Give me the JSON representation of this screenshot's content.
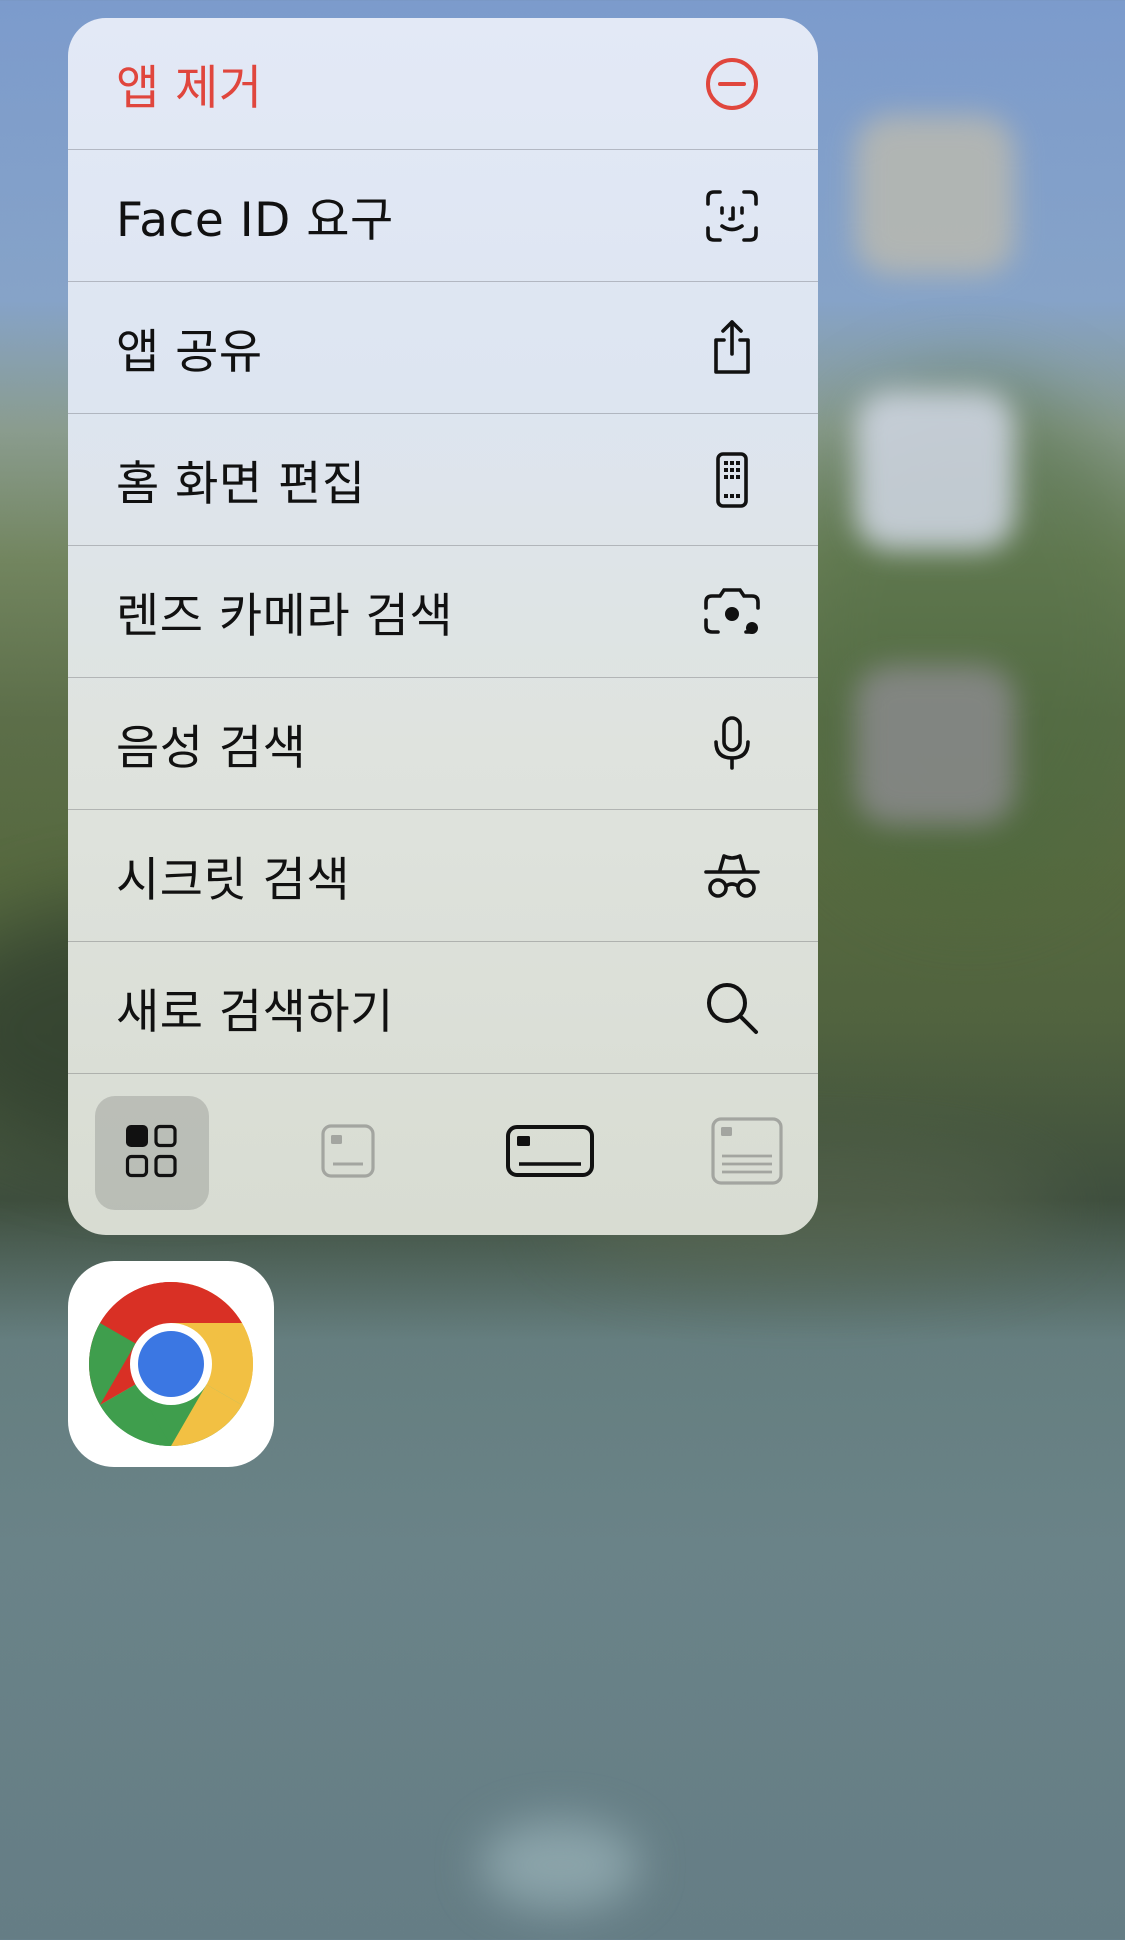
{
  "menu": {
    "items": [
      {
        "label": "앱 제거",
        "icon": "minus-circle-icon",
        "danger": true
      },
      {
        "label": "Face ID 요구",
        "icon": "face-id-icon"
      },
      {
        "label": "앱 공유",
        "icon": "share-icon"
      },
      {
        "label": "홈 화면 편집",
        "icon": "phone-apps-icon"
      },
      {
        "label": "렌즈 카메라 검색",
        "icon": "lens-camera-icon"
      },
      {
        "label": "음성 검색",
        "icon": "microphone-icon"
      },
      {
        "label": "시크릿 검색",
        "icon": "incognito-icon"
      },
      {
        "label": "새로 검색하기",
        "icon": "search-icon"
      }
    ],
    "size_options": [
      {
        "icon": "icon-only-size-icon",
        "selected": true
      },
      {
        "icon": "small-widget-size-icon",
        "selected": false
      },
      {
        "icon": "medium-widget-size-icon",
        "selected": false
      },
      {
        "icon": "large-widget-size-icon",
        "selected": false
      }
    ]
  },
  "app": {
    "icon": "chrome-app-icon"
  },
  "colors": {
    "danger": "#e0463d",
    "text": "#111111",
    "chrome_red": "#d93025",
    "chrome_yellow": "#f2c043",
    "chrome_green": "#3f9e4d",
    "chrome_blue": "#3b77e3"
  }
}
